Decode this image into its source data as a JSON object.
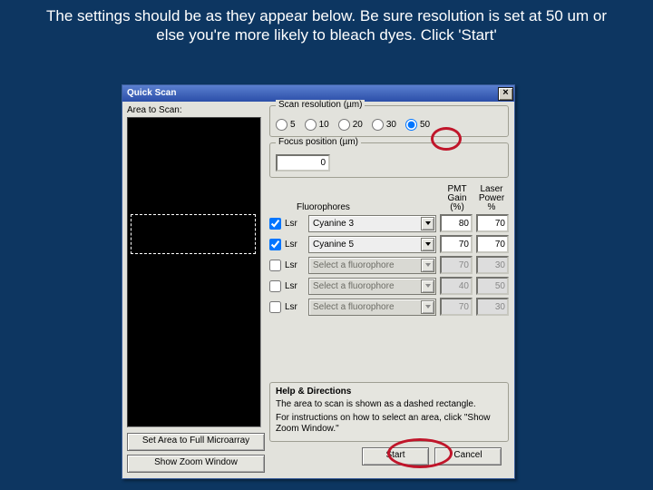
{
  "slide": {
    "instruction": "The settings should be as they appear below. Be sure resolution is set at 50 um or else you're more likely to bleach dyes. Click 'Start'"
  },
  "dialog": {
    "title": "Quick Scan",
    "close_glyph": "×",
    "area_caption": "Area to Scan:",
    "left_buttons": {
      "set_area": "Set Area to Full Microarray",
      "show_zoom": "Show Zoom Window"
    },
    "scan_res": {
      "legend": "Scan resolution (µm)",
      "options": [
        "5",
        "10",
        "20",
        "30",
        "50"
      ],
      "selected": "50"
    },
    "focus": {
      "legend": "Focus position (µm)",
      "value": "0"
    },
    "fluoro": {
      "label": "Fluorophores",
      "pmt_col": "PMT\nGain (%)",
      "laser_col": "Laser\nPower %",
      "rows": [
        {
          "id": "Lsr",
          "checked": true,
          "name": "Cyanine 3",
          "pmt": "80",
          "laser": "70",
          "enabled": true
        },
        {
          "id": "Lsr",
          "checked": true,
          "name": "Cyanine 5",
          "pmt": "70",
          "laser": "70",
          "enabled": true
        },
        {
          "id": "Lsr",
          "checked": false,
          "name": "Select a fluorophore",
          "pmt": "70",
          "laser": "30",
          "enabled": false
        },
        {
          "id": "Lsr",
          "checked": false,
          "name": "Select a fluorophore",
          "pmt": "40",
          "laser": "50",
          "enabled": false
        },
        {
          "id": "Lsr",
          "checked": false,
          "name": "Select a fluorophore",
          "pmt": "70",
          "laser": "30",
          "enabled": false
        }
      ]
    },
    "help": {
      "title": "Help & Directions",
      "line1": "The area to scan is shown as a dashed rectangle.",
      "line2": "For instructions on how to select an area, click \"Show Zoom Window.\""
    },
    "footer": {
      "start": "Start",
      "cancel": "Cancel"
    }
  }
}
